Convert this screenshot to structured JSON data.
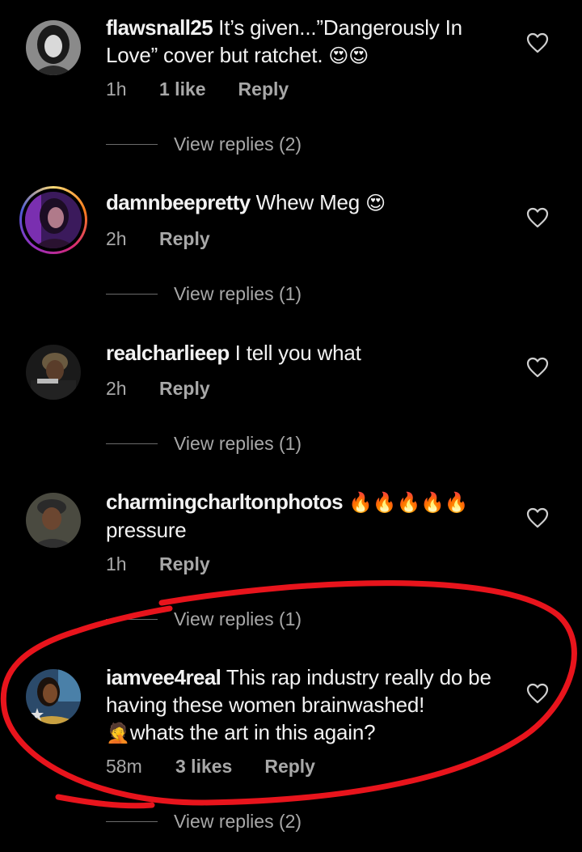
{
  "comments": [
    {
      "username": "flawsnall25",
      "text": "It’s given...”Dangerously In Love” cover but ratchet.",
      "emojis": "😍😍",
      "time": "1h",
      "likes": "1 like",
      "reply_label": "Reply",
      "view_replies": "View replies (2)",
      "avatar_story_ring": false
    },
    {
      "username": "damnbeepretty",
      "text": "Whew Meg",
      "emojis": "😍",
      "time": "2h",
      "likes": "",
      "reply_label": "Reply",
      "view_replies": "View replies (1)",
      "avatar_story_ring": true
    },
    {
      "username": "realcharlieep",
      "text": "I tell you what",
      "emojis": "",
      "time": "2h",
      "likes": "",
      "reply_label": "Reply",
      "view_replies": "View replies (1)",
      "avatar_story_ring": false
    },
    {
      "username": "charmingcharltonphotos",
      "text": "pressure",
      "emojis": "🔥🔥🔥🔥🔥",
      "time": "1h",
      "likes": "",
      "reply_label": "Reply",
      "view_replies": "View replies (1)",
      "avatar_story_ring": false
    },
    {
      "username": "iamvee4real",
      "text": "This rap industry really do be having these women brainwashed!",
      "text2": "whats the art in this again?",
      "emojis": "🤦",
      "time": "58m",
      "likes": "3 likes",
      "reply_label": "Reply",
      "view_replies": "View replies (2)",
      "avatar_story_ring": false
    }
  ],
  "colors": {
    "background": "#000000",
    "text": "#f2f2f2",
    "muted": "#a8a8a8",
    "annotation": "#e8141c"
  },
  "icons": {
    "like": "heart-outline-icon"
  }
}
